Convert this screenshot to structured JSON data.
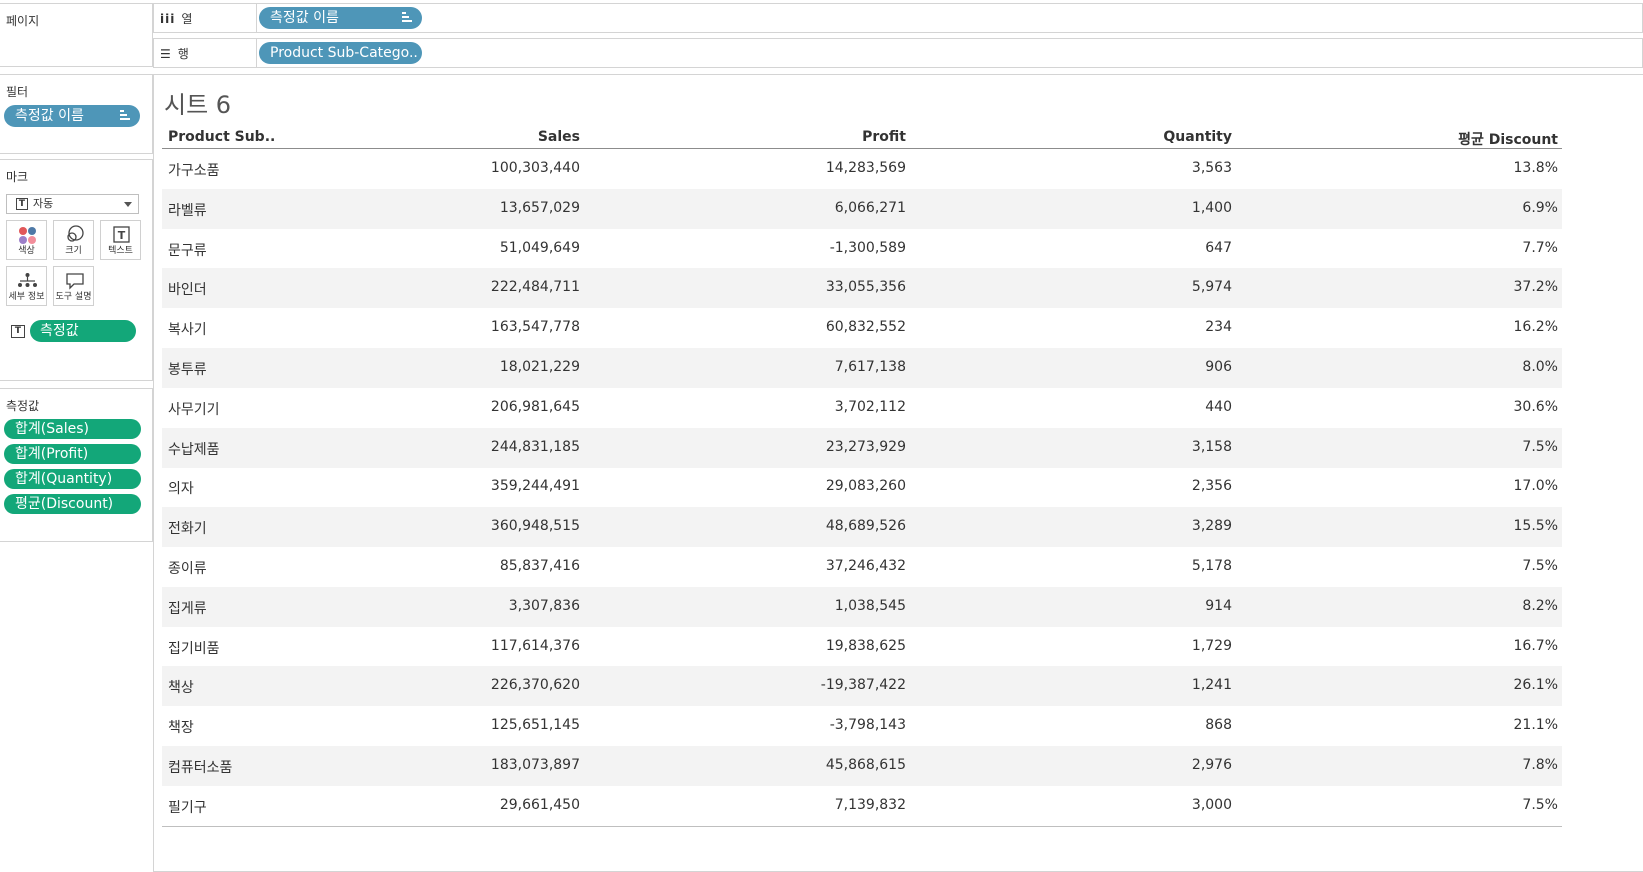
{
  "panels": {
    "pages_title": "페이지",
    "filters_title": "필터",
    "marks_title": "마크",
    "measures_title": "측정값"
  },
  "filters": {
    "pill": "측정값 이름"
  },
  "marks": {
    "type": "자동",
    "buttons": {
      "color": "색상",
      "size": "크기",
      "text": "텍스트",
      "detail": "세부 정보",
      "tooltip": "도구 설명"
    },
    "text_pill": "측정값"
  },
  "measures": [
    "합계(Sales)",
    "합계(Profit)",
    "합계(Quantity)",
    "평균(Discount)"
  ],
  "shelves": {
    "columns_label": "열",
    "columns_pill": "측정값 이름",
    "rows_label": "행",
    "rows_pill": "Product Sub-Catego.."
  },
  "sheet": {
    "title": "시트 6"
  },
  "table": {
    "headers": [
      "Product Sub..",
      "Sales",
      "Profit",
      "Quantity",
      "평균 Discount"
    ],
    "rows": [
      [
        "가구소품",
        "100,303,440",
        "14,283,569",
        "3,563",
        "13.8%"
      ],
      [
        "라벨류",
        "13,657,029",
        "6,066,271",
        "1,400",
        "6.9%"
      ],
      [
        "문구류",
        "51,049,649",
        "-1,300,589",
        "647",
        "7.7%"
      ],
      [
        "바인더",
        "222,484,711",
        "33,055,356",
        "5,974",
        "37.2%"
      ],
      [
        "복사기",
        "163,547,778",
        "60,832,552",
        "234",
        "16.2%"
      ],
      [
        "봉투류",
        "18,021,229",
        "7,617,138",
        "906",
        "8.0%"
      ],
      [
        "사무기기",
        "206,981,645",
        "3,702,112",
        "440",
        "30.6%"
      ],
      [
        "수납제품",
        "244,831,185",
        "23,273,929",
        "3,158",
        "7.5%"
      ],
      [
        "의자",
        "359,244,491",
        "29,083,260",
        "2,356",
        "17.0%"
      ],
      [
        "전화기",
        "360,948,515",
        "48,689,526",
        "3,289",
        "15.5%"
      ],
      [
        "종이류",
        "85,837,416",
        "37,246,432",
        "5,178",
        "7.5%"
      ],
      [
        "집게류",
        "3,307,836",
        "1,038,545",
        "914",
        "8.2%"
      ],
      [
        "집기비품",
        "117,614,376",
        "19,838,625",
        "1,729",
        "16.7%"
      ],
      [
        "책상",
        "226,370,620",
        "-19,387,422",
        "1,241",
        "26.1%"
      ],
      [
        "책장",
        "125,651,145",
        "-3,798,143",
        "868",
        "21.1%"
      ],
      [
        "컴퓨터소품",
        "183,073,897",
        "45,868,615",
        "2,976",
        "7.8%"
      ],
      [
        "필기구",
        "29,661,450",
        "7,139,832",
        "3,000",
        "7.5%"
      ]
    ]
  },
  "colors": {
    "dimension_pill": "#4e96b8",
    "measure_pill": "#13a779",
    "alt_row": "#f3f3f3"
  }
}
